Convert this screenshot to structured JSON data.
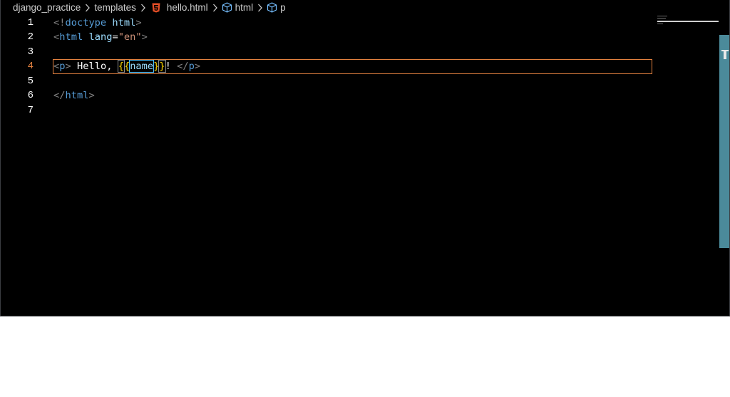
{
  "breadcrumb": {
    "items": [
      {
        "label": "django_practice"
      },
      {
        "label": "templates"
      },
      {
        "label": "hello.html"
      },
      {
        "label": "html"
      },
      {
        "label": "p"
      }
    ]
  },
  "editor": {
    "active_line": 4,
    "line_numbers": [
      "1",
      "2",
      "3",
      "4",
      "5",
      "6",
      "7"
    ],
    "lines": {
      "l1": {
        "open": "<!",
        "kw": "doctype",
        "sp": " ",
        "tag": "html",
        "close": ">"
      },
      "l2": {
        "open": "<",
        "tag": "html",
        "sp": " ",
        "attr": "lang",
        "eq": "=",
        "str": "\"en\"",
        "close": ">"
      },
      "l4": {
        "open1": "<",
        "tag1": "p",
        "close1": ">",
        "text": " Hello, ",
        "brace_open": "{",
        "brace_open2": "{",
        "var": "name",
        "brace_close": "}",
        "brace_close2": "}",
        "bang": "! ",
        "open2": "</",
        "tag2": "p",
        "close2": ">"
      },
      "l6": {
        "open": "</",
        "tag": "html",
        "close": ">"
      }
    }
  },
  "colors": {
    "background": "#000000",
    "tag": "#569cd6",
    "attribute": "#9cdcfe",
    "string": "#ce9178",
    "active_line_border": "#e2813f",
    "scrollbar_thumb": "#4b8a9a"
  },
  "icons": {
    "file_icon": "html5-icon",
    "symbol_icon": "cube-icon",
    "separator_icon": "chevron-right-icon"
  }
}
